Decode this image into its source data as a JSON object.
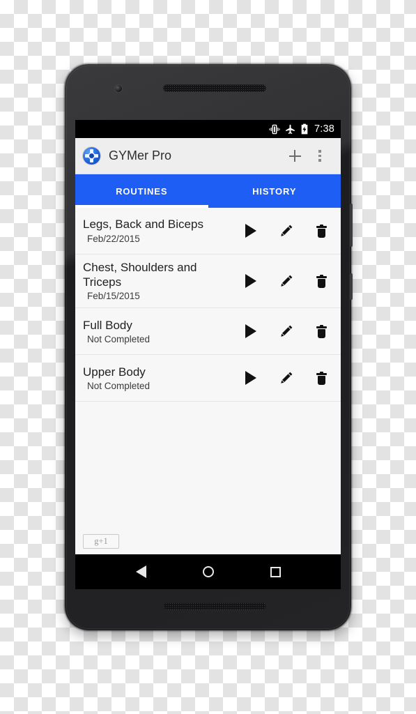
{
  "status_bar": {
    "icons": [
      "vibrate-icon",
      "airplane-mode-icon",
      "battery-charging-icon"
    ],
    "time": "7:38"
  },
  "toolbar": {
    "app_icon": "gymer-app-icon",
    "title": "GYMer Pro",
    "add_label": "+",
    "overflow_label": "⋮"
  },
  "tabs": [
    {
      "label": "ROUTINES",
      "active": true
    },
    {
      "label": "HISTORY",
      "active": false
    }
  ],
  "routines": [
    {
      "title": "Legs, Back and Biceps",
      "subtitle": "Feb/22/2015"
    },
    {
      "title": "Chest, Shoulders and Triceps",
      "subtitle": "Feb/15/2015"
    },
    {
      "title": "Full Body",
      "subtitle": "Not Completed"
    },
    {
      "title": "Upper Body",
      "subtitle": "Not Completed"
    }
  ],
  "row_actions": {
    "play": "play-icon",
    "edit": "edit-pencil-icon",
    "delete": "delete-trash-icon"
  },
  "social": {
    "gplus_label": "g+1"
  },
  "nav_bar": {
    "back": "back-icon",
    "home": "home-icon",
    "recents": "recents-icon"
  },
  "colors": {
    "accent_blue": "#1f5ef5",
    "toolbar_bg": "#eeeeee",
    "screen_bg": "#f7f7f7",
    "status_bar_bg": "#000000"
  }
}
